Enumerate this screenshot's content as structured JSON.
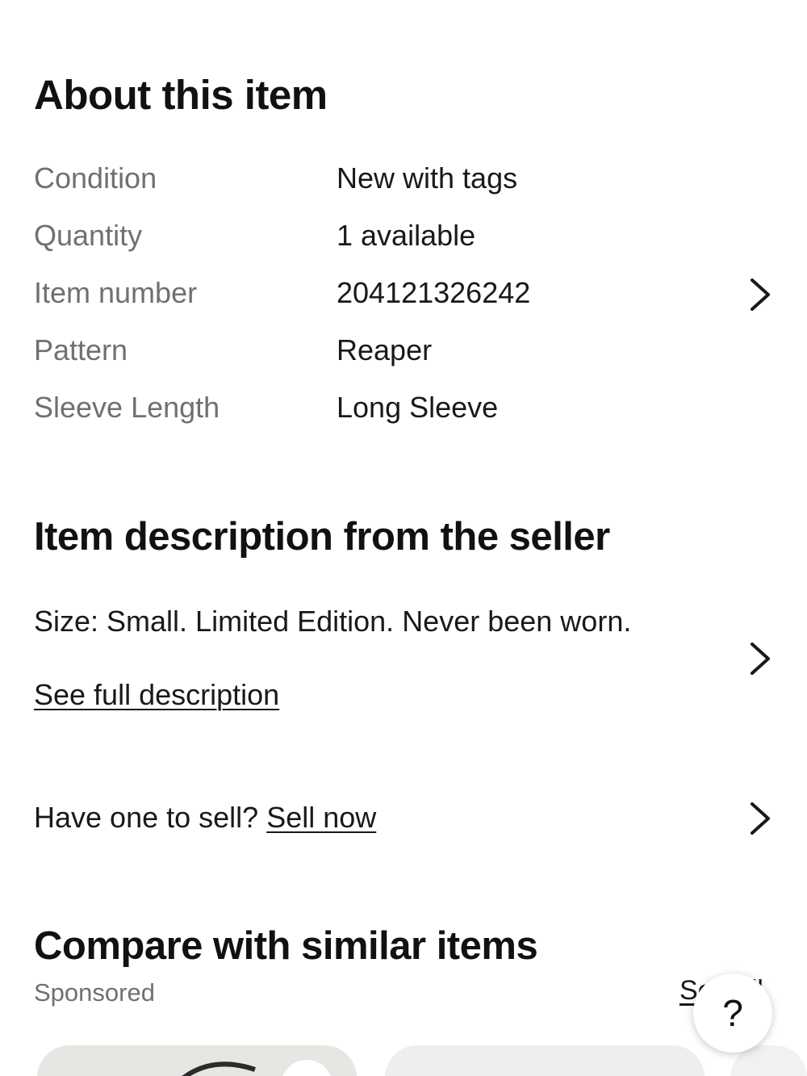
{
  "about": {
    "title": "About this item",
    "specs": [
      {
        "label": "Condition",
        "value": "New with tags"
      },
      {
        "label": "Quantity",
        "value": "1 available"
      },
      {
        "label": "Item number",
        "value": "204121326242"
      },
      {
        "label": "Pattern",
        "value": "Reaper"
      },
      {
        "label": "Sleeve Length",
        "value": "Long Sleeve"
      }
    ]
  },
  "description": {
    "title": "Item description from the seller",
    "text": "Size: Small. Limited Edition. Never been worn.",
    "see_full_link": "See full description"
  },
  "sell": {
    "prompt": "Have one to sell?",
    "link": "Sell now"
  },
  "compare": {
    "title": "Compare with similar items",
    "sponsored": "Sponsored",
    "see_all": "See all"
  },
  "help_button": {
    "label": "?"
  },
  "icons": {
    "chevron": "chevron-right-icon",
    "help": "help-icon"
  },
  "colors": {
    "text": "#191919",
    "muted": "#707070",
    "background": "#ffffff"
  }
}
